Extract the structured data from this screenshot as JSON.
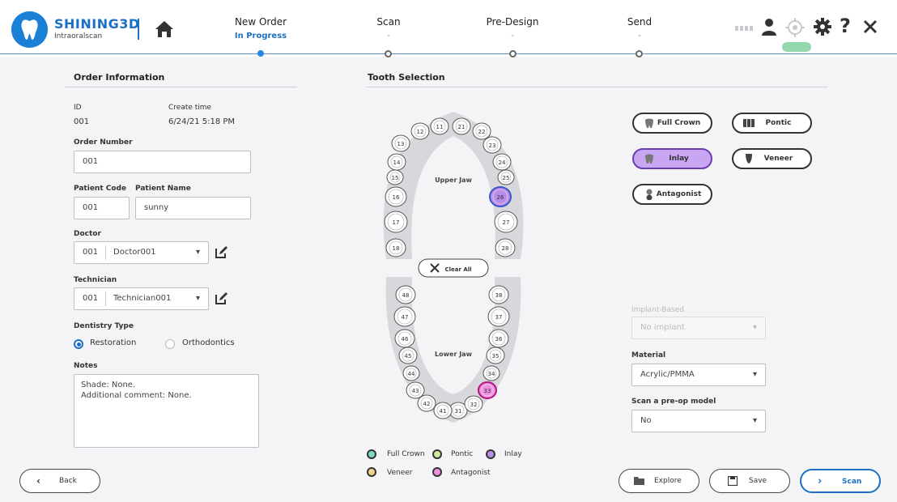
{
  "brand": {
    "name": "SHINING3D",
    "product": "Intraoralscan"
  },
  "steps": [
    {
      "label": "New Order",
      "status": "In Progress"
    },
    {
      "label": "Scan",
      "status": "-"
    },
    {
      "label": "Pre-Design",
      "status": "-"
    },
    {
      "label": "Send",
      "status": "-"
    }
  ],
  "order_info": {
    "title": "Order Information",
    "id_label": "ID",
    "id_value": "001",
    "create_time_label": "Create time",
    "create_time_value": "6/24/21 5:18 PM",
    "order_number_label": "Order Number",
    "order_number_value": "001",
    "patient_code_label": "Patient Code",
    "patient_code_value": "001",
    "patient_name_label": "Patient Name",
    "patient_name_value": "sunny",
    "doctor_label": "Doctor",
    "doctor_code": "001",
    "doctor_name": "Doctor001",
    "technician_label": "Technician",
    "technician_code": "001",
    "technician_name": "Technician001",
    "dentistry_type_label": "Dentistry Type",
    "restoration_label": "Restoration",
    "orthodontics_label": "Orthodontics",
    "notes_label": "Notes",
    "notes_line1": "Shade: None.",
    "notes_line2": "Additional comment: None."
  },
  "tooth_selection": {
    "title": "Tooth Selection",
    "upper_jaw_label": "Upper Jaw",
    "lower_jaw_label": "Lower Jaw",
    "clear_all_label": "Clear All",
    "upper_right": [
      "11",
      "12",
      "13",
      "14",
      "15",
      "16",
      "17",
      "18"
    ],
    "upper_left": [
      "21",
      "22",
      "23",
      "24",
      "25",
      "26",
      "27",
      "28"
    ],
    "lower_left": [
      "31",
      "32",
      "33",
      "34",
      "35",
      "36",
      "37",
      "38"
    ],
    "lower_right": [
      "41",
      "42",
      "43",
      "44",
      "45",
      "46",
      "47",
      "48"
    ],
    "selected": {
      "26": "Inlay",
      "33": "Antagonist"
    }
  },
  "restoration_types": {
    "full_crown": "Full Crown",
    "pontic": "Pontic",
    "inlay": "Inlay",
    "veneer": "Veneer",
    "antagonist": "Antagonist",
    "selected": "Inlay"
  },
  "legend": {
    "full_crown": "Full Crown",
    "pontic": "Pontic",
    "inlay": "Inlay",
    "veneer": "Veneer",
    "antagonist": "Antagonist"
  },
  "colors": {
    "full_crown": "#7dd9c4",
    "pontic": "#cfe9a0",
    "inlay": "#b98ce8",
    "veneer": "#f1d38b",
    "antagonist": "#ef8fe0",
    "accent": "#1b6fc4",
    "inlay_selected_bg": "#c9a6f2"
  },
  "options": {
    "implant_label": "Implant-Based",
    "implant_value": "No implant",
    "material_label": "Material",
    "material_value": "Acrylic/PMMA",
    "preop_label": "Scan a pre-op model",
    "preop_value": "No"
  },
  "footer": {
    "back_label": "Back",
    "explore_label": "Explore",
    "save_label": "Save",
    "scan_label": "Scan"
  }
}
